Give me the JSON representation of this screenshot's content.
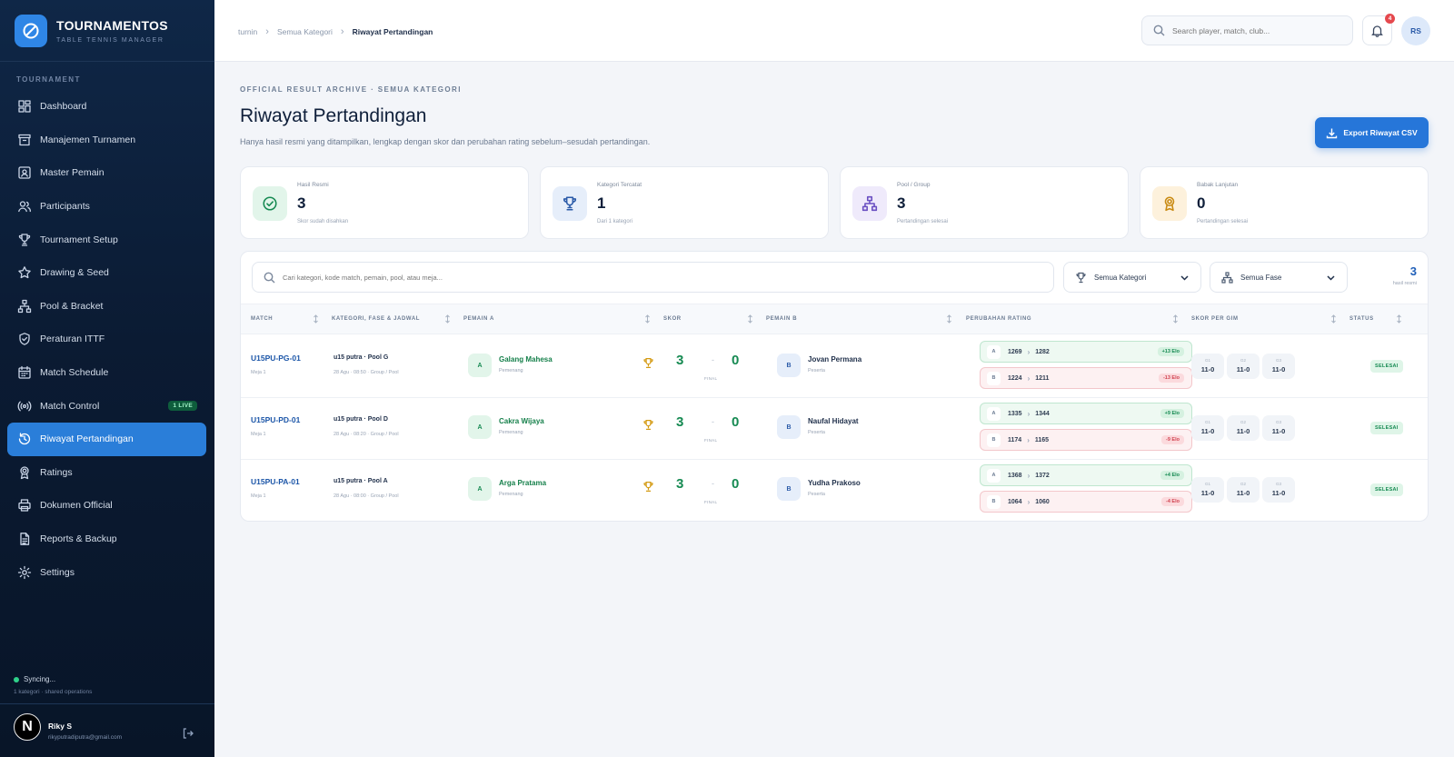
{
  "brand": {
    "title": "TOURNAMENTOS",
    "subtitle": "TABLE TENNIS MANAGER"
  },
  "sidebar": {
    "section": "TOURNAMENT",
    "items": [
      {
        "label": "Dashboard",
        "icon": "dashboard-icon"
      },
      {
        "label": "Manajemen Turnamen",
        "icon": "archive-icon"
      },
      {
        "label": "Master Pemain",
        "icon": "id-card-icon"
      },
      {
        "label": "Participants",
        "icon": "users-icon"
      },
      {
        "label": "Tournament Setup",
        "icon": "trophy-icon"
      },
      {
        "label": "Drawing & Seed",
        "icon": "star-icon"
      },
      {
        "label": "Pool & Bracket",
        "icon": "network-icon"
      },
      {
        "label": "Peraturan ITTF",
        "icon": "shield-icon"
      },
      {
        "label": "Match Schedule",
        "icon": "calendar-icon"
      },
      {
        "label": "Match Control",
        "icon": "broadcast-icon",
        "badge": "1 LIVE"
      },
      {
        "label": "Riwayat Pertandingan",
        "icon": "history-icon",
        "active": true
      },
      {
        "label": "Ratings",
        "icon": "medal-icon"
      },
      {
        "label": "Dokumen Official",
        "icon": "printer-icon"
      },
      {
        "label": "Reports & Backup",
        "icon": "file-icon"
      },
      {
        "label": "Settings",
        "icon": "gear-icon"
      }
    ],
    "sync": {
      "status": "Syncing...",
      "detail": "1 kategori · shared operations"
    },
    "user": {
      "initial": "N",
      "name": "Riky S",
      "email": "rikyputradiputra@gmail.com"
    }
  },
  "header": {
    "breadcrumb": [
      "turnin",
      "Semua Kategori",
      "Riwayat Pertandingan"
    ],
    "search_placeholder": "Search player, match, club...",
    "notif_count": "4",
    "avatar": "RS"
  },
  "page": {
    "eyebrow": "OFFICIAL RESULT ARCHIVE · SEMUA KATEGORI",
    "title": "Riwayat Pertandingan",
    "subtitle": "Hanya hasil resmi yang ditampilkan, lengkap dengan skor dan perubahan rating sebelum–sesudah pertandingan.",
    "export_label": "Export Riwayat CSV"
  },
  "colors": {
    "accent": "#2676d9",
    "success": "#168a52",
    "danger": "#d14250"
  },
  "stats": [
    {
      "label": "Hasil Resmi",
      "value": "3",
      "sub": "Skor sudah disahkan",
      "icon": "check-circle-icon",
      "bg": "#e2f5ea",
      "color": "#168a52"
    },
    {
      "label": "Kategori Tercatat",
      "value": "1",
      "sub": "Dari 1 kategori",
      "icon": "trophy-icon",
      "bg": "#e6eefa",
      "color": "#2a5aa8"
    },
    {
      "label": "Pool / Group",
      "value": "3",
      "sub": "Pertandingan selesai",
      "icon": "network-icon",
      "bg": "#efeafb",
      "color": "#6a4fc2"
    },
    {
      "label": "Babak Lanjutan",
      "value": "0",
      "sub": "Pertandingan selesai",
      "icon": "medal-icon",
      "bg": "#fdf1dc",
      "color": "#c98a12"
    }
  ],
  "filters": {
    "search_placeholder": "Cari kategori, kode match, pemain, pool, atau meja...",
    "kategori": "Semua Kategori",
    "fase": "Semua Fase",
    "count": "3",
    "count_label": "hasil resmi"
  },
  "table": {
    "columns": [
      "MATCH",
      "KATEGORI, FASE & JADWAL",
      "PEMAIN A",
      "SKOR",
      "PEMAIN B",
      "PERUBAHAN RATING",
      "SKOR PER GIM",
      "STATUS"
    ],
    "rows": [
      {
        "code": "U15PU-PG-01",
        "meja": "Meja 1",
        "kategori": "u15 putra · Pool G",
        "jadwal": "28 Agu · 08:50 · Group / Pool",
        "a_initial": "A",
        "a_name": "Galang Mahesa",
        "a_role": "Pemenang",
        "score_a": "3",
        "score_sep": "-",
        "score_b": "0",
        "score_label": "FINAL",
        "b_initial": "B",
        "b_name": "Jovan Permana",
        "b_role": "Peserta",
        "ra_label": "A",
        "ra_before": "1269",
        "ra_after": "1282",
        "ra_delta": "+13 Elo",
        "rb_label": "B",
        "rb_before": "1224",
        "rb_after": "1211",
        "rb_delta": "-13 Elo",
        "games": [
          {
            "label": "G1",
            "score": "11-0"
          },
          {
            "label": "G2",
            "score": "11-0"
          },
          {
            "label": "G3",
            "score": "11-0"
          }
        ],
        "status": "SELESAI"
      },
      {
        "code": "U15PU-PD-01",
        "meja": "Meja 1",
        "kategori": "u15 putra · Pool D",
        "jadwal": "28 Agu · 08:20 · Group / Pool",
        "a_initial": "A",
        "a_name": "Cakra Wijaya",
        "a_role": "Pemenang",
        "score_a": "3",
        "score_sep": "-",
        "score_b": "0",
        "score_label": "FINAL",
        "b_initial": "B",
        "b_name": "Naufal Hidayat",
        "b_role": "Peserta",
        "ra_label": "A",
        "ra_before": "1335",
        "ra_after": "1344",
        "ra_delta": "+9 Elo",
        "rb_label": "B",
        "rb_before": "1174",
        "rb_after": "1165",
        "rb_delta": "-9 Elo",
        "games": [
          {
            "label": "G1",
            "score": "11-0"
          },
          {
            "label": "G2",
            "score": "11-0"
          },
          {
            "label": "G3",
            "score": "11-0"
          }
        ],
        "status": "SELESAI"
      },
      {
        "code": "U15PU-PA-01",
        "meja": "Meja 1",
        "kategori": "u15 putra · Pool A",
        "jadwal": "28 Agu · 08:00 · Group / Pool",
        "a_initial": "A",
        "a_name": "Arga Pratama",
        "a_role": "Pemenang",
        "score_a": "3",
        "score_sep": "-",
        "score_b": "0",
        "score_label": "FINAL",
        "b_initial": "B",
        "b_name": "Yudha Prakoso",
        "b_role": "Peserta",
        "ra_label": "A",
        "ra_before": "1368",
        "ra_after": "1372",
        "ra_delta": "+4 Elo",
        "rb_label": "B",
        "rb_before": "1064",
        "rb_after": "1060",
        "rb_delta": "-4 Elo",
        "games": [
          {
            "label": "G1",
            "score": "11-0"
          },
          {
            "label": "G2",
            "score": "11-0"
          },
          {
            "label": "G3",
            "score": "11-0"
          }
        ],
        "status": "SELESAI"
      }
    ]
  }
}
